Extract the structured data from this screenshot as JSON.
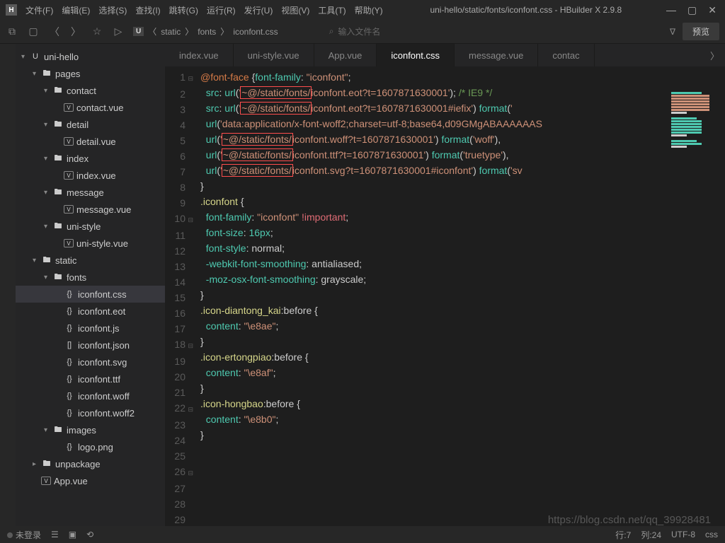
{
  "app": {
    "logo": "H",
    "title": "uni-hello/static/fonts/iconfont.css - HBuilder X 2.9.8",
    "version": "2.9.8"
  },
  "menu": [
    "文件(F)",
    "编辑(E)",
    "选择(S)",
    "查找(I)",
    "跳转(G)",
    "运行(R)",
    "发行(U)",
    "视图(V)",
    "工具(T)",
    "帮助(Y)"
  ],
  "toolbar": {
    "breadcrumb_box": "U",
    "breadcrumb": [
      "static",
      "fonts",
      "iconfont.css"
    ],
    "search_placeholder": "输入文件名",
    "preview": "预览"
  },
  "tree": [
    {
      "d": 0,
      "chev": "▾",
      "ico": "U",
      "label": "uni-hello",
      "type": "box"
    },
    {
      "d": 1,
      "chev": "▾",
      "ico": "📁",
      "label": "pages",
      "type": "folder"
    },
    {
      "d": 2,
      "chev": "▾",
      "ico": "📁",
      "label": "contact",
      "type": "folder"
    },
    {
      "d": 3,
      "chev": "",
      "ico": "V",
      "label": "contact.vue",
      "type": "vue"
    },
    {
      "d": 2,
      "chev": "▾",
      "ico": "📁",
      "label": "detail",
      "type": "folder"
    },
    {
      "d": 3,
      "chev": "",
      "ico": "V",
      "label": "detail.vue",
      "type": "vue"
    },
    {
      "d": 2,
      "chev": "▾",
      "ico": "📁",
      "label": "index",
      "type": "folder"
    },
    {
      "d": 3,
      "chev": "",
      "ico": "V",
      "label": "index.vue",
      "type": "vue"
    },
    {
      "d": 2,
      "chev": "▾",
      "ico": "📁",
      "label": "message",
      "type": "folder"
    },
    {
      "d": 3,
      "chev": "",
      "ico": "V",
      "label": "message.vue",
      "type": "vue"
    },
    {
      "d": 2,
      "chev": "▾",
      "ico": "📁",
      "label": "uni-style",
      "type": "folder"
    },
    {
      "d": 3,
      "chev": "",
      "ico": "V",
      "label": "uni-style.vue",
      "type": "vue"
    },
    {
      "d": 1,
      "chev": "▾",
      "ico": "📁",
      "label": "static",
      "type": "folder"
    },
    {
      "d": 2,
      "chev": "▾",
      "ico": "📁",
      "label": "fonts",
      "type": "folder"
    },
    {
      "d": 3,
      "chev": "",
      "ico": "{}",
      "label": "iconfont.css",
      "type": "braces",
      "active": true
    },
    {
      "d": 3,
      "chev": "",
      "ico": "{}",
      "label": "iconfont.eot",
      "type": "braces"
    },
    {
      "d": 3,
      "chev": "",
      "ico": "{}",
      "label": "iconfont.js",
      "type": "braces"
    },
    {
      "d": 3,
      "chev": "",
      "ico": "[]",
      "label": "iconfont.json",
      "type": "brackets"
    },
    {
      "d": 3,
      "chev": "",
      "ico": "{}",
      "label": "iconfont.svg",
      "type": "braces"
    },
    {
      "d": 3,
      "chev": "",
      "ico": "{}",
      "label": "iconfont.ttf",
      "type": "braces"
    },
    {
      "d": 3,
      "chev": "",
      "ico": "{}",
      "label": "iconfont.woff",
      "type": "braces"
    },
    {
      "d": 3,
      "chev": "",
      "ico": "{}",
      "label": "iconfont.woff2",
      "type": "braces"
    },
    {
      "d": 2,
      "chev": "▾",
      "ico": "📁",
      "label": "images",
      "type": "folder"
    },
    {
      "d": 3,
      "chev": "",
      "ico": "{}",
      "label": "logo.png",
      "type": "braces"
    },
    {
      "d": 1,
      "chev": "▸",
      "ico": "📁",
      "label": "unpackage",
      "type": "folder"
    },
    {
      "d": 1,
      "chev": "",
      "ico": "V",
      "label": "App.vue",
      "type": "vue"
    }
  ],
  "tabs": [
    {
      "label": "index.vue",
      "active": false
    },
    {
      "label": "uni-style.vue",
      "active": false
    },
    {
      "label": "App.vue",
      "active": false
    },
    {
      "label": "iconfont.css",
      "active": true
    },
    {
      "label": "message.vue",
      "active": false
    },
    {
      "label": "contac",
      "active": false
    }
  ],
  "code": {
    "lines": [
      {
        "n": 1,
        "fold": "⊟",
        "segs": [
          [
            "c-at",
            "@font-face"
          ],
          [
            "c-punc",
            " "
          ],
          [
            "c-brace",
            "{"
          ],
          [
            "c-prop",
            "font-family"
          ],
          [
            "c-punc",
            ": "
          ],
          [
            "c-str",
            "\"iconfont\""
          ],
          [
            "c-punc",
            ";"
          ]
        ]
      },
      {
        "n": 2,
        "segs": [
          [
            "c-punc",
            "  "
          ],
          [
            "c-prop",
            "src"
          ],
          [
            "c-punc",
            ": "
          ],
          [
            "c-fn",
            "url"
          ],
          [
            "c-punc",
            "("
          ],
          [
            "c-str",
            "'"
          ],
          [
            "hl c-str",
            "~@/static/fonts/"
          ],
          [
            "c-str",
            "iconfont.eot?t=1607871630001'"
          ],
          [
            "c-punc",
            ");"
          ],
          [
            "c-punc",
            " "
          ],
          [
            "c-cmt",
            "/* IE9 */"
          ]
        ]
      },
      {
        "n": 3,
        "segs": [
          [
            "c-punc",
            "  "
          ],
          [
            "c-prop",
            "src"
          ],
          [
            "c-punc",
            ": "
          ],
          [
            "c-fn",
            "url"
          ],
          [
            "c-punc",
            "("
          ],
          [
            "c-str",
            "'"
          ],
          [
            "hl c-str",
            "~@/static/fonts/"
          ],
          [
            "c-str",
            "iconfont.eot?t=1607871630001#iefix'"
          ],
          [
            "c-punc",
            ") "
          ],
          [
            "c-fn",
            "format"
          ],
          [
            "c-punc",
            "("
          ],
          [
            "c-str",
            "'"
          ]
        ]
      },
      {
        "n": 4,
        "segs": [
          [
            "c-punc",
            "  "
          ],
          [
            "c-fn",
            "url"
          ],
          [
            "c-punc",
            "("
          ],
          [
            "c-str",
            "'data:application/x-font-woff2;charset=utf-8;base64,d09GMgABAAAAAAS"
          ]
        ]
      },
      {
        "n": 5,
        "segs": [
          [
            "c-punc",
            "  "
          ],
          [
            "c-fn",
            "url"
          ],
          [
            "c-punc",
            "("
          ],
          [
            "c-str",
            "'"
          ],
          [
            "hl c-str",
            "~@/static/fonts/"
          ],
          [
            "c-str",
            "iconfont.woff?t=1607871630001'"
          ],
          [
            "c-punc",
            ") "
          ],
          [
            "c-fn",
            "format"
          ],
          [
            "c-punc",
            "("
          ],
          [
            "c-str",
            "'woff'"
          ],
          [
            "c-punc",
            "),"
          ]
        ]
      },
      {
        "n": 6,
        "segs": [
          [
            "c-punc",
            "  "
          ],
          [
            "c-fn",
            "url"
          ],
          [
            "c-punc",
            "("
          ],
          [
            "c-str",
            "'"
          ],
          [
            "hl c-str",
            "~@/static/fonts/"
          ],
          [
            "c-str",
            "iconfont.ttf?t=1607871630001'"
          ],
          [
            "c-punc",
            ") "
          ],
          [
            "c-fn",
            "format"
          ],
          [
            "c-punc",
            "("
          ],
          [
            "c-str",
            "'truetype'"
          ],
          [
            "c-punc",
            "),"
          ]
        ]
      },
      {
        "n": 7,
        "segs": [
          [
            "c-punc",
            "  "
          ],
          [
            "c-fn",
            "url"
          ],
          [
            "c-punc",
            "("
          ],
          [
            "c-str",
            "'"
          ],
          [
            "hl c-str",
            "~@/static/fonts/"
          ],
          [
            "c-str",
            "iconfont.svg?t=1607871630001#iconfont'"
          ],
          [
            "c-punc",
            ") "
          ],
          [
            "c-fn",
            "format"
          ],
          [
            "c-punc",
            "("
          ],
          [
            "c-str",
            "'sv"
          ]
        ]
      },
      {
        "n": 8,
        "segs": [
          [
            "c-brace",
            "}"
          ]
        ]
      },
      {
        "n": 9,
        "segs": [
          [
            "",
            ""
          ]
        ]
      },
      {
        "n": 10,
        "fold": "⊟",
        "segs": [
          [
            "c-sel",
            ".iconfont"
          ],
          [
            "c-punc",
            " "
          ],
          [
            "c-brace",
            "{"
          ]
        ]
      },
      {
        "n": 11,
        "segs": [
          [
            "c-punc",
            "  "
          ],
          [
            "c-prop",
            "font-family"
          ],
          [
            "c-punc",
            ": "
          ],
          [
            "c-str",
            "\"iconfont\""
          ],
          [
            "c-punc",
            " "
          ],
          [
            "c-imp",
            "!important"
          ],
          [
            "c-punc",
            ";"
          ]
        ]
      },
      {
        "n": 12,
        "segs": [
          [
            "c-punc",
            "  "
          ],
          [
            "c-prop",
            "font-size"
          ],
          [
            "c-punc",
            ": "
          ],
          [
            "c-num",
            "16px"
          ],
          [
            "c-punc",
            ";"
          ]
        ]
      },
      {
        "n": 13,
        "segs": [
          [
            "c-punc",
            "  "
          ],
          [
            "c-prop",
            "font-style"
          ],
          [
            "c-punc",
            ": normal;"
          ]
        ]
      },
      {
        "n": 14,
        "segs": [
          [
            "c-punc",
            "  "
          ],
          [
            "c-prop",
            "-webkit-font-smoothing"
          ],
          [
            "c-punc",
            ": antialiased;"
          ]
        ]
      },
      {
        "n": 15,
        "segs": [
          [
            "c-punc",
            "  "
          ],
          [
            "c-prop",
            "-moz-osx-font-smoothing"
          ],
          [
            "c-punc",
            ": grayscale;"
          ]
        ]
      },
      {
        "n": 16,
        "segs": [
          [
            "c-brace",
            "}"
          ]
        ]
      },
      {
        "n": 17,
        "segs": [
          [
            "",
            ""
          ]
        ]
      },
      {
        "n": 18,
        "fold": "⊟",
        "segs": [
          [
            "c-sel",
            ".icon-diantong_kai"
          ],
          [
            "c-punc",
            ":before "
          ],
          [
            "c-brace",
            "{"
          ]
        ]
      },
      {
        "n": 19,
        "segs": [
          [
            "c-punc",
            "  "
          ],
          [
            "c-prop",
            "content"
          ],
          [
            "c-punc",
            ": "
          ],
          [
            "c-str",
            "\"\\e8ae\""
          ],
          [
            "c-punc",
            ";"
          ]
        ]
      },
      {
        "n": 20,
        "segs": [
          [
            "c-brace",
            "}"
          ]
        ]
      },
      {
        "n": 21,
        "segs": [
          [
            "",
            ""
          ]
        ]
      },
      {
        "n": 22,
        "fold": "⊟",
        "segs": [
          [
            "c-sel",
            ".icon-ertongpiao"
          ],
          [
            "c-punc",
            ":before "
          ],
          [
            "c-brace",
            "{"
          ]
        ]
      },
      {
        "n": 23,
        "segs": [
          [
            "c-punc",
            "  "
          ],
          [
            "c-prop",
            "content"
          ],
          [
            "c-punc",
            ": "
          ],
          [
            "c-str",
            "\"\\e8af\""
          ],
          [
            "c-punc",
            ";"
          ]
        ]
      },
      {
        "n": 24,
        "segs": [
          [
            "c-brace",
            "}"
          ]
        ]
      },
      {
        "n": 25,
        "segs": [
          [
            "",
            ""
          ]
        ]
      },
      {
        "n": 26,
        "fold": "⊟",
        "segs": [
          [
            "c-sel",
            ".icon-hongbao"
          ],
          [
            "c-punc",
            ":before "
          ],
          [
            "c-brace",
            "{"
          ]
        ]
      },
      {
        "n": 27,
        "segs": [
          [
            "c-punc",
            "  "
          ],
          [
            "c-prop",
            "content"
          ],
          [
            "c-punc",
            ": "
          ],
          [
            "c-str",
            "\"\\e8b0\""
          ],
          [
            "c-punc",
            ";"
          ]
        ]
      },
      {
        "n": 28,
        "segs": [
          [
            "c-brace",
            "}"
          ]
        ]
      },
      {
        "n": 29,
        "segs": [
          [
            "",
            ""
          ]
        ]
      }
    ]
  },
  "status": {
    "login": "未登录",
    "line": "行:7",
    "col": "列:24",
    "enc": "UTF-8",
    "lang": "css"
  },
  "watermark": "https://blog.csdn.net/qq_39928481"
}
